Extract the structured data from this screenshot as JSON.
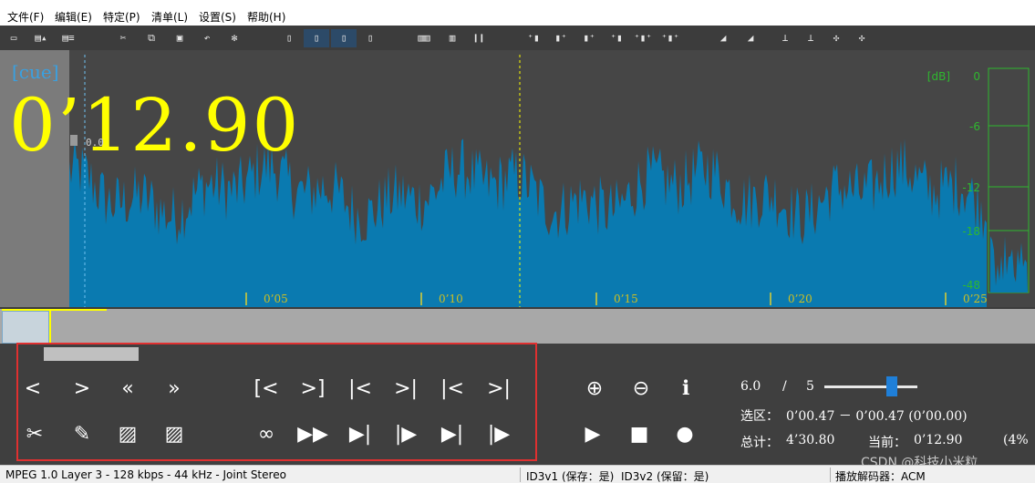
{
  "menu": [
    "文件(F)",
    "编辑(E)",
    "特定(P)",
    "清单(L)",
    "设置(S)",
    "帮助(H)"
  ],
  "wave": {
    "cue_label": "[cue]",
    "big_time": "0’12.90",
    "zero_label": "0.0",
    "db_unit": "[dB]",
    "db_scale": [
      "0",
      "-6",
      "-12",
      "-18",
      "-48"
    ],
    "time_ticks": [
      "0’05",
      "0’10",
      "0’15",
      "0’20",
      "0’25"
    ],
    "waveform_color": "#0a7ab0",
    "cursor_color": "#ffff00"
  },
  "controls": {
    "nav_row1": [
      "<",
      ">",
      "«",
      "»"
    ],
    "nav_row2_icons": [
      "scissors-icon",
      "pencil-icon",
      "hatch-icon",
      "hatch2-icon"
    ],
    "mark_row1": [
      "[<",
      ">]",
      "|<",
      ">|",
      "|<",
      ">|"
    ],
    "mark_row2": [
      "∞",
      "▶▶",
      "▶|",
      "|▶",
      "▶|",
      "|▶"
    ],
    "volume": "6.0",
    "volume_sep": "/",
    "volume_max": "5",
    "selection_label": "选区：",
    "selection_value": "0’00.47 － 0’00.47 (0’00.00)",
    "total_label": "总计：",
    "total_value": "4’30.80",
    "current_label": "当前：",
    "current_value": "0’12.90",
    "percent": "(4%"
  },
  "status": {
    "codec": "MPEG 1.0 Layer 3  -  128 kbps  -  44 kHz  -  Joint Stereo",
    "id3v1": "ID3v1 (保存：是)",
    "id3v2": "ID3v2 (保留：是)",
    "decoder": "播放解码器：ACM"
  },
  "watermark": "CSDN @科技小米粒"
}
